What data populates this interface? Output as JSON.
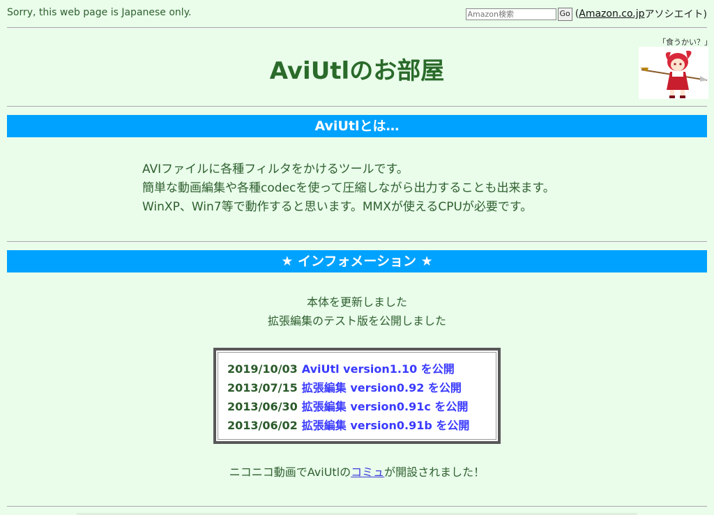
{
  "header": {
    "sorry_text": "Sorry, this web page is Japanese only.",
    "amazon_placeholder": "Amazon検索",
    "go_label": "Go",
    "paren_open": "(",
    "amazon_link": "Amazon.co.jp",
    "associate_text": "アソシエイト)"
  },
  "title": "AviUtlのお部屋",
  "mascot": {
    "caption": "「食うかい？」"
  },
  "about": {
    "heading": "AviUtlとは…",
    "lines": [
      "AVIファイルに各種フィルタをかけるツールです。",
      "簡単な動画編集や各種codecを使って圧縮しながら出力することも出来ます。",
      "WinXP、Win7等で動作すると思います。MMXが使えるCPUが必要です。"
    ]
  },
  "info": {
    "heading": "★ インフォメーション ★",
    "lines": [
      "本体を更新しました",
      "拡張編集のテスト版を公開しました"
    ],
    "news": [
      {
        "date": "2019/10/03",
        "text": "AviUtl version1.10 を公開"
      },
      {
        "date": "2013/07/15",
        "text": "拡張編集 version0.92 を公開"
      },
      {
        "date": "2013/06/30",
        "text": "拡張編集 version0.91c を公開"
      },
      {
        "date": "2013/06/02",
        "text": "拡張編集 version0.91b を公開"
      }
    ],
    "niconico_prefix": "ニコニコ動画でAviUtlの",
    "niconico_link": "コミュ",
    "niconico_suffix": "が開設されました！"
  },
  "colors": {
    "background": "#e9fdea",
    "band": "#00a2ff",
    "title": "#2a6a2a",
    "link_blue": "#3a3aff"
  }
}
